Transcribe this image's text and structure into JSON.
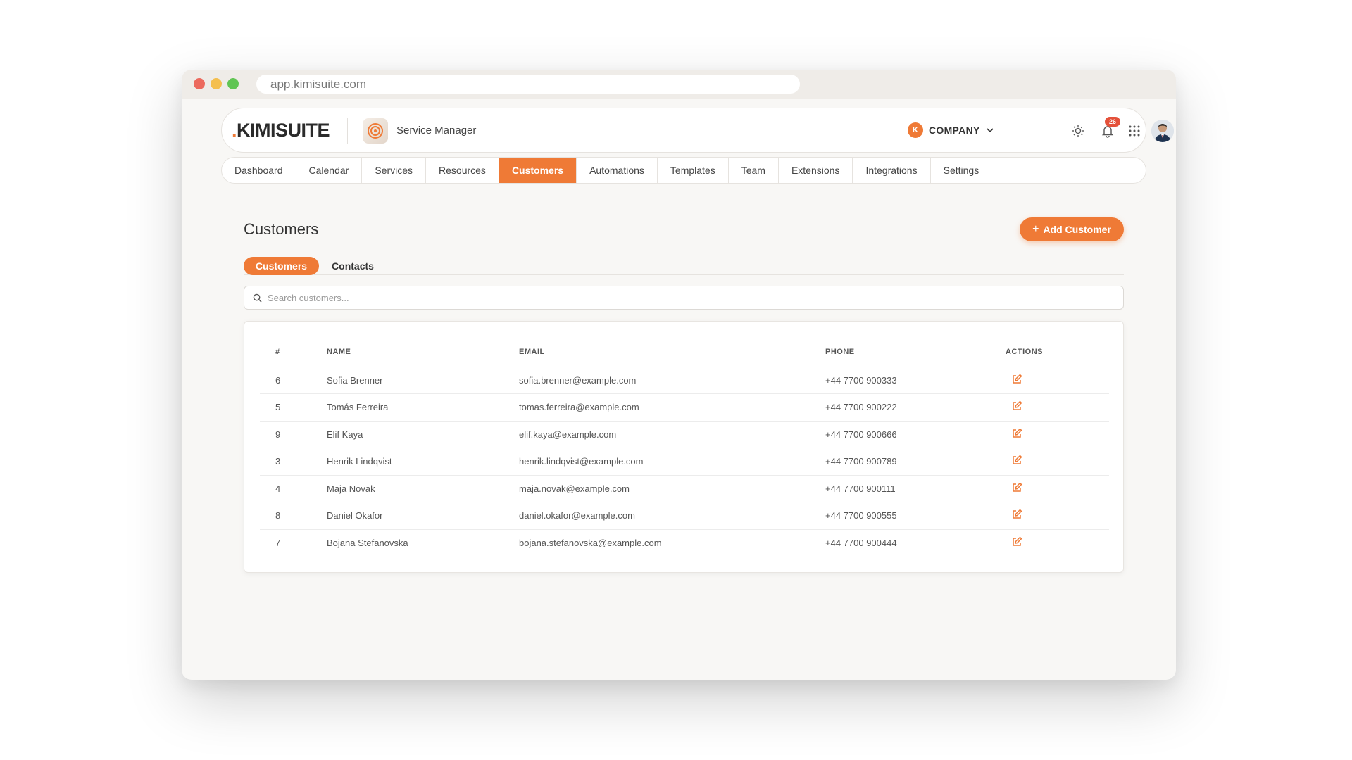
{
  "browser": {
    "url": "app.kimisuite.com"
  },
  "header": {
    "logo_dot": ".",
    "logo_text": "KIMISUITE",
    "app_name": "Service Manager",
    "company_initial": "K",
    "company_label": "COMPANY",
    "notifications_count": "26",
    "icons": [
      "sun-icon",
      "bell-icon",
      "apps-grid-icon",
      "chevron-down-icon"
    ]
  },
  "nav": {
    "items": [
      {
        "label": "Dashboard"
      },
      {
        "label": "Calendar"
      },
      {
        "label": "Services"
      },
      {
        "label": "Resources"
      },
      {
        "label": "Customers"
      },
      {
        "label": "Automations"
      },
      {
        "label": "Templates"
      },
      {
        "label": "Team"
      },
      {
        "label": "Extensions"
      },
      {
        "label": "Integrations"
      },
      {
        "label": "Settings"
      }
    ],
    "active": "Customers"
  },
  "page": {
    "title": "Customers",
    "add_button_label": "Add Customer",
    "add_button_icon": "+",
    "tabs": [
      {
        "label": "Customers"
      },
      {
        "label": "Contacts"
      }
    ],
    "search_placeholder": "Search customers..."
  },
  "table": {
    "headers": {
      "id": "#",
      "name": "NAME",
      "email": "EMAIL",
      "phone": "PHONE",
      "actions": "ACTIONS"
    },
    "rows": [
      {
        "id": "6",
        "name": "Sofia Brenner",
        "email": "sofia.brenner@example.com",
        "phone": "+44 7700 900333"
      },
      {
        "id": "5",
        "name": "Tomás Ferreira",
        "email": "tomas.ferreira@example.com",
        "phone": "+44 7700 900222"
      },
      {
        "id": "9",
        "name": "Elif Kaya",
        "email": "elif.kaya@example.com",
        "phone": "+44 7700 900666"
      },
      {
        "id": "3",
        "name": "Henrik Lindqvist",
        "email": "henrik.lindqvist@example.com",
        "phone": "+44 7700 900789"
      },
      {
        "id": "4",
        "name": "Maja Novak",
        "email": "maja.novak@example.com",
        "phone": "+44 7700 900111"
      },
      {
        "id": "8",
        "name": "Daniel Okafor",
        "email": "daniel.okafor@example.com",
        "phone": "+44 7700 900555"
      },
      {
        "id": "7",
        "name": "Bojana Stefanovska",
        "email": "bojana.stefanovska@example.com",
        "phone": "+44 7700 900444"
      }
    ]
  },
  "colors": {
    "accent": "#ef7a36",
    "badge": "#e4513a"
  }
}
